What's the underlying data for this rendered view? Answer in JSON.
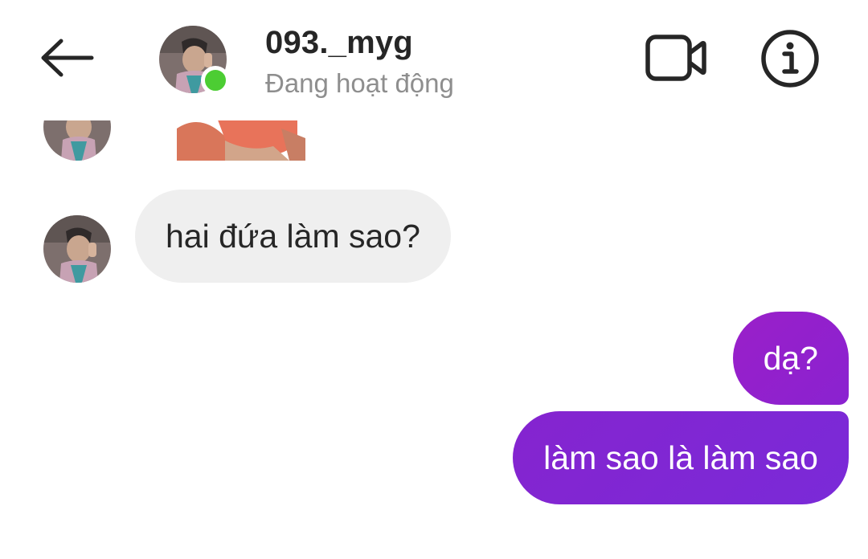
{
  "header": {
    "back_icon": "arrow-left-icon",
    "user_name": "093._myg",
    "user_status": "Đang hoạt động",
    "online_color": "#4ccd33",
    "video_icon": "video-camera-icon",
    "info_icon": "info-icon"
  },
  "messages": [
    {
      "direction": "incoming",
      "text": "hai đứa làm sao?"
    },
    {
      "direction": "outgoing",
      "text": "dạ?"
    },
    {
      "direction": "outgoing",
      "text": "làm sao là làm sao"
    }
  ],
  "colors": {
    "incoming_bubble": "#efefef",
    "outgoing_bubble": "#8a22d0",
    "status_text": "#8e8e8e"
  }
}
